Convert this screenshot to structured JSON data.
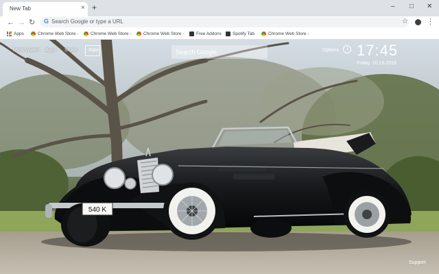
{
  "browser": {
    "tab_title": "New Tab",
    "tab_close": "×",
    "new_tab": "+",
    "window_controls": [
      "–",
      "□",
      "✕"
    ],
    "omnibox_placeholder": "Search Google or type a URL",
    "bookmarks": [
      {
        "label": "Apps",
        "icon": "apps-grid-icon"
      },
      {
        "label": "Chrome Web Store -",
        "icon": "chrome-web-store-icon"
      },
      {
        "label": "Chrome Web Store -",
        "icon": "chrome-web-store-icon"
      },
      {
        "label": "Chrome Web Store -",
        "icon": "chrome-web-store-icon"
      },
      {
        "label": "Free Addons",
        "icon": "bookmark-icon"
      },
      {
        "label": "Spotify Tab",
        "icon": "bookmark-icon"
      },
      {
        "label": "Chrome Web Store -",
        "icon": "chrome-web-store-icon"
      }
    ]
  },
  "ntp": {
    "nav": [
      "Most Visited",
      "Apps",
      "Share",
      "Rate"
    ],
    "search_placeholder": "Search Google",
    "options_label": "Options",
    "time": "17:45",
    "date": "Friday, 10.19.2018",
    "plate": "540 K",
    "support_label": "Support"
  },
  "colors": {
    "tabstrip": "#dee1e6",
    "car_body": "#141516",
    "whitewall": "#f2f2ee",
    "sky": "#c9d3db",
    "grass": "#8ea55a",
    "gravel": "#b2ab9d"
  }
}
